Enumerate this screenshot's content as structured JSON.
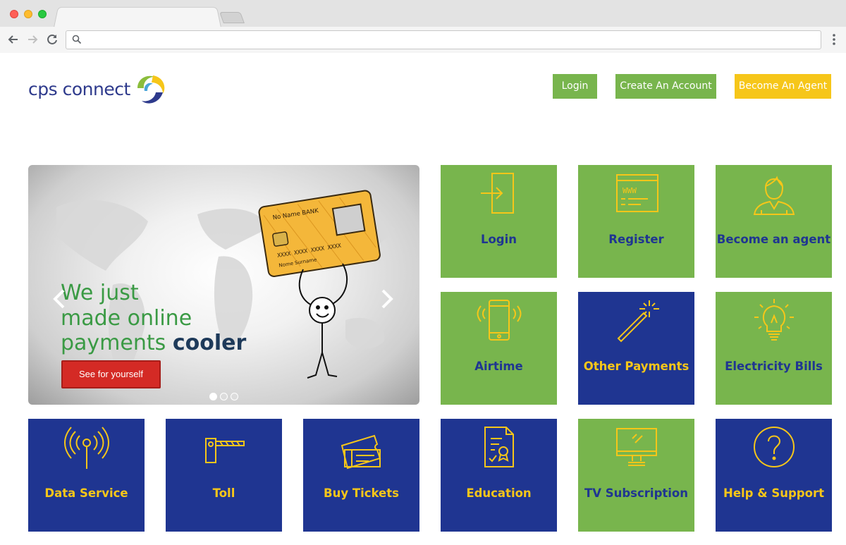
{
  "browser": {
    "address_value": "",
    "icons": [
      "back-icon",
      "forward-icon",
      "reload-icon",
      "search-icon",
      "menu-icon"
    ]
  },
  "brand": {
    "name": "cps connect",
    "colors": {
      "green": "#78b54d",
      "blue": "#1f3591",
      "yellow": "#f6c619",
      "red": "#d42a25"
    }
  },
  "header": {
    "login_label": "Login",
    "create_account_label": "Create An Account",
    "become_agent_label": "Become An Agent"
  },
  "slider": {
    "line1": "We just",
    "line2": "made online",
    "line3_prefix": "payments ",
    "line3_bold": "cooler",
    "cta_label": "See for yourself",
    "card_bank": "No Name BANK",
    "card_number": "XXXX XXXX XXXX XXXX",
    "card_holder": "Nome Surname",
    "slide_count": 3,
    "active_slide": 1
  },
  "tiles": [
    {
      "label": "Login",
      "icon": "login-door-icon",
      "color": "green"
    },
    {
      "label": "Register",
      "icon": "www-browser-icon",
      "color": "green"
    },
    {
      "label": "Become an agent",
      "icon": "person-agent-icon",
      "color": "green"
    },
    {
      "label": "Airtime",
      "icon": "phone-vibrate-icon",
      "color": "green"
    },
    {
      "label": "Other Payments",
      "icon": "magic-wand-icon",
      "color": "blue"
    },
    {
      "label": "Electricity Bills",
      "icon": "light-bulb-icon",
      "color": "green"
    },
    {
      "label": "Data Service",
      "icon": "antenna-signal-icon",
      "color": "blue"
    },
    {
      "label": "Toll",
      "icon": "toll-barrier-icon",
      "color": "blue"
    },
    {
      "label": "Buy Tickets",
      "icon": "tickets-icon",
      "color": "blue"
    },
    {
      "label": "Education",
      "icon": "certificate-icon",
      "color": "blue"
    },
    {
      "label": "TV Subscription",
      "icon": "monitor-icon",
      "color": "green"
    },
    {
      "label": "Help & Support",
      "icon": "question-circle-icon",
      "color": "blue"
    }
  ]
}
